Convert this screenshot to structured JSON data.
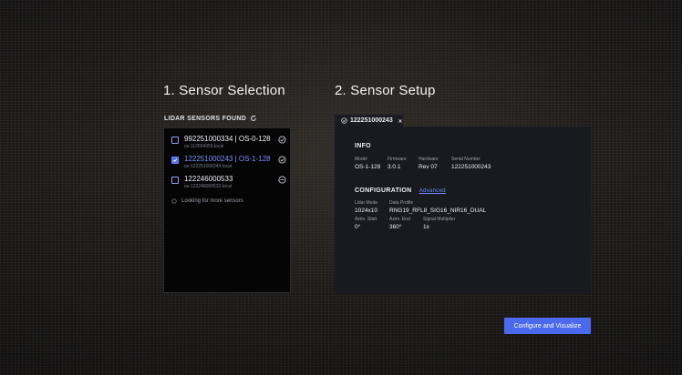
{
  "steps": {
    "selection_title": "1. Sensor Selection",
    "setup_title": "2. Sensor Setup"
  },
  "sensor_list": {
    "header": "LIDAR SENSORS FOUND",
    "sensors": [
      {
        "name": "992251000334 | OS-0-128",
        "host": "os-113554959.local",
        "checked": false,
        "status_icon": "check-circle-icon"
      },
      {
        "name": "122251000243 | OS-1-128",
        "host": "os-122251000243.local",
        "checked": true,
        "status_icon": "check-circle-icon"
      },
      {
        "name": "122246000533",
        "host": "os-122246000533.local",
        "checked": false,
        "status_icon": "minus-circle-icon"
      }
    ],
    "looking_text": "Looking for more sensors"
  },
  "setup": {
    "tab_label": "122251000243",
    "info": {
      "title": "INFO",
      "model_label": "Model",
      "model": "OS-1-128",
      "firmware_label": "Firmware",
      "firmware": "3.0.1",
      "hardware_label": "Hardware",
      "hardware": "Rev 07",
      "serial_label": "Serial Number",
      "serial": "122251000243"
    },
    "config": {
      "title": "CONFIGURATION",
      "advanced_link": "Advanced",
      "lidar_mode_label": "Lidar Mode",
      "lidar_mode": "1024x10",
      "data_profile_label": "Data Profile",
      "data_profile": "RNG19_RFL8_SIG16_NIR16_DUAL",
      "azim_start_label": "Azim. Start",
      "azim_start": "0°",
      "azim_end_label": "Azim. End",
      "azim_end": "360°",
      "signal_mult_label": "Signal Multiplier",
      "signal_mult": "1x"
    }
  },
  "cta_label": "Configure and Visualize",
  "colors": {
    "accent": "#4b69ec",
    "link": "#6f8cff",
    "panel": "#181a20"
  }
}
